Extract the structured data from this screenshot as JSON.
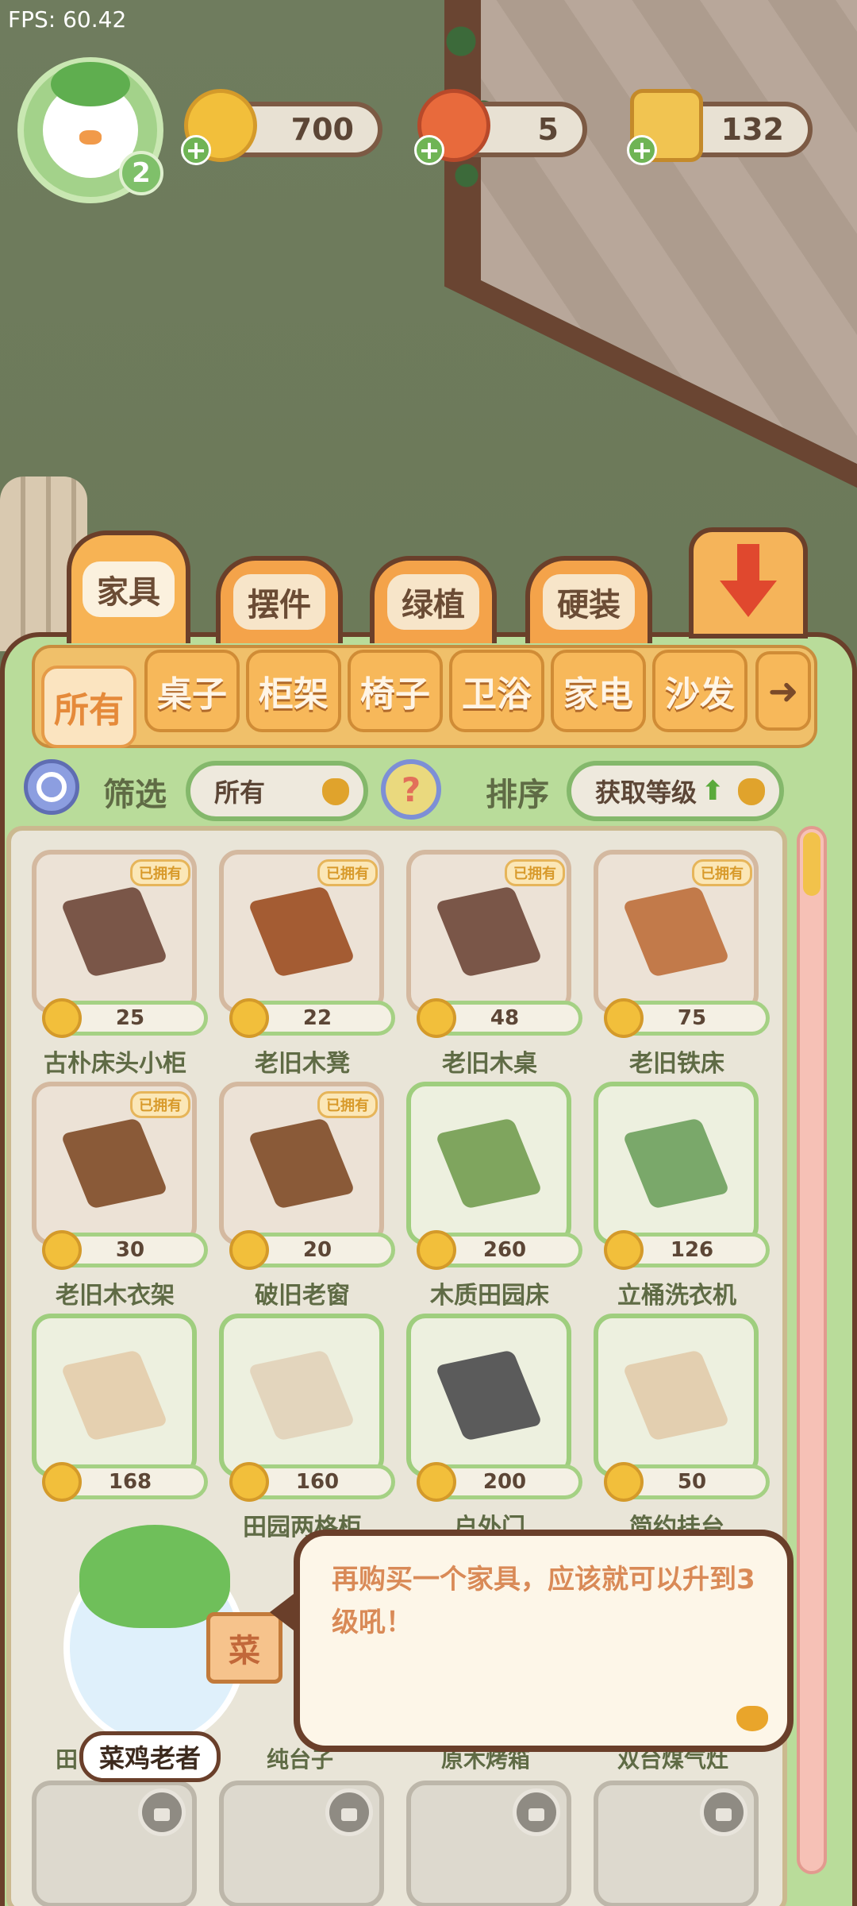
{
  "fps": "FPS: 60.42",
  "player": {
    "level": "2"
  },
  "resources": [
    {
      "name": "coins",
      "icon": "heart-coin-icon",
      "value": "700"
    },
    {
      "name": "vegetables",
      "icon": "carrot-icon",
      "value": "5"
    },
    {
      "name": "tickets",
      "icon": "star-ticket-icon",
      "value": "132"
    }
  ],
  "category_tabs": [
    "家具",
    "摆件",
    "绿植",
    "硬装"
  ],
  "sub_tabs": [
    "所有",
    "桌子",
    "柜架",
    "椅子",
    "卫浴",
    "家电",
    "沙发"
  ],
  "filter": {
    "label": "筛选",
    "value": "所有"
  },
  "sort": {
    "label": "排序",
    "value": "获取等级"
  },
  "owned_label": "已拥有",
  "items": [
    {
      "name": "古朴床头小柜",
      "price": "25",
      "owned": true
    },
    {
      "name": "老旧木凳",
      "price": "22",
      "owned": true
    },
    {
      "name": "老旧木桌",
      "price": "48",
      "owned": true
    },
    {
      "name": "老旧铁床",
      "price": "75",
      "owned": true
    },
    {
      "name": "老旧木衣架",
      "price": "30",
      "owned": true
    },
    {
      "name": "破旧老窗",
      "price": "20",
      "owned": true
    },
    {
      "name": "木质田园床",
      "price": "260",
      "owned": false
    },
    {
      "name": "立桶洗衣机",
      "price": "126",
      "owned": false
    },
    {
      "name": "",
      "price": "168",
      "owned": false
    },
    {
      "name": "田园两格柜",
      "price": "160",
      "owned": false
    },
    {
      "name": "户外门",
      "price": "200",
      "owned": false
    },
    {
      "name": "简约挂台",
      "price": "50",
      "owned": false
    }
  ],
  "partial_names": [
    "田",
    "纯台子",
    "原木烤箱",
    "双台煤气灶"
  ],
  "mascot": {
    "name": "菜鸡老者",
    "book_char": "菜"
  },
  "speech": {
    "text": "再购买一个家具，应该就可以升到3级吼！"
  },
  "colors": {
    "coin": "#f2bf3b",
    "panel": "#b9dc9a",
    "tab": "#f4a34a",
    "dark_brown": "#6a3f2a"
  }
}
